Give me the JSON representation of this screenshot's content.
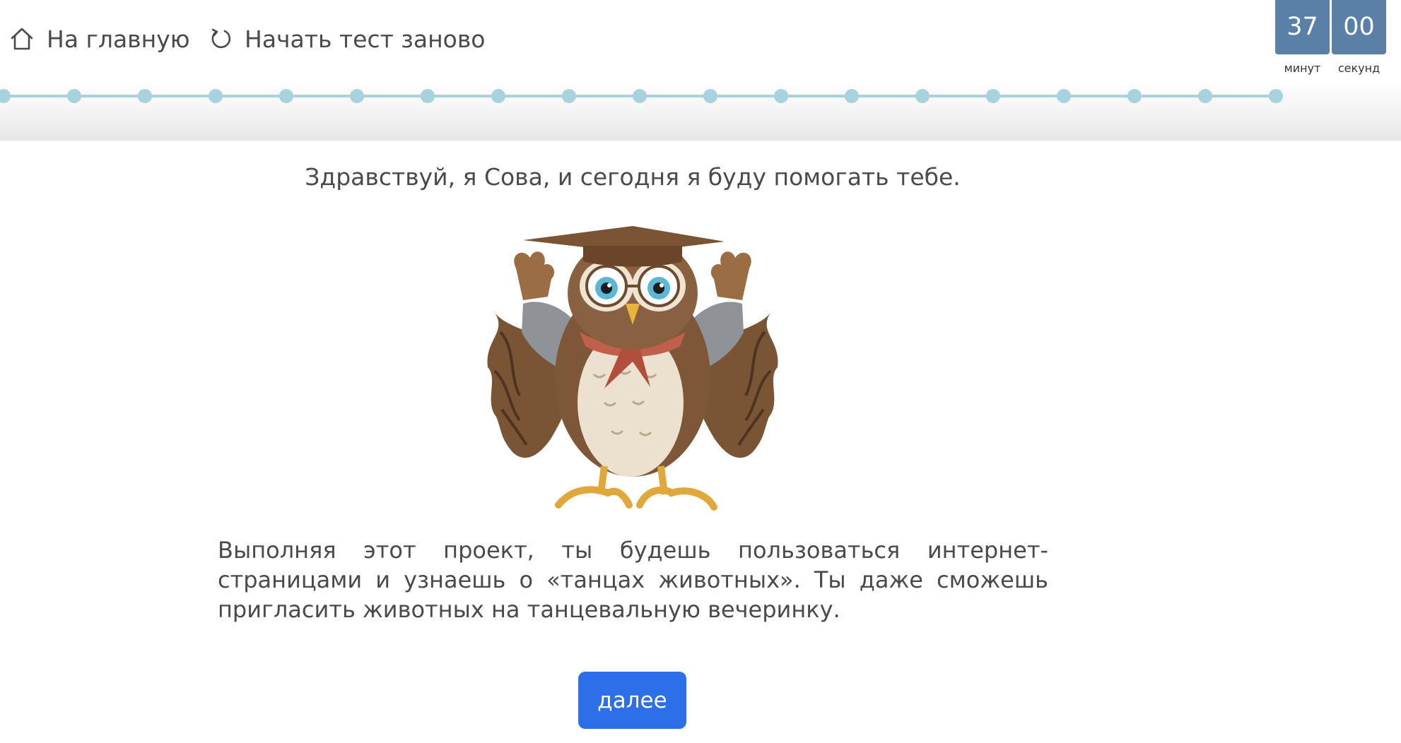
{
  "nav": {
    "home_label": "На главную",
    "restart_label": "Начать тест заново",
    "home_icon": "home-icon",
    "restart_icon": "refresh-icon"
  },
  "timer": {
    "minutes": "37",
    "seconds": "00",
    "minutes_label": "минут",
    "seconds_label": "секунд"
  },
  "progress": {
    "total_steps": 19,
    "color": "#a9d2df"
  },
  "content": {
    "greeting": "Здравствуй, я Сова, и сегодня я буду помогать тебе.",
    "owl_image": "owl-mascot-illustration",
    "description": "Выполняя этот проект, ты будешь пользоваться интернет-страницами и узнаешь о «танцах животных». Ты даже сможешь пригласить животных на танцевальную вечеринку."
  },
  "actions": {
    "next_label": "далее"
  },
  "colors": {
    "timer_bg": "#5b80a8",
    "button_bg": "#2d6fe8",
    "text": "#4a4a4a"
  }
}
